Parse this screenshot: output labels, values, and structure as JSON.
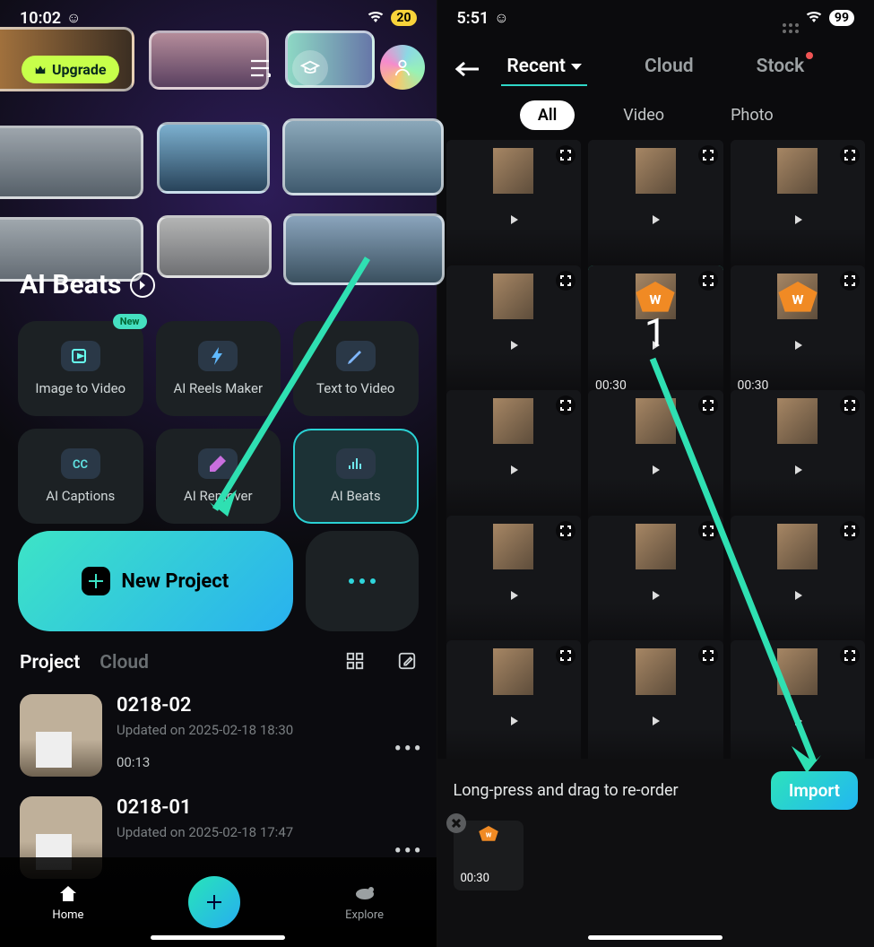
{
  "left": {
    "status_time": "10:02",
    "status_emoji": "☺",
    "battery": "20",
    "upgrade_label": "Upgrade",
    "section_title": "AI Beats",
    "tools": [
      {
        "label": "Image to Video",
        "badge": "New"
      },
      {
        "label": "AI Reels Maker"
      },
      {
        "label": "Text  to Video"
      },
      {
        "label": "AI Captions"
      },
      {
        "label": "AI Remover"
      },
      {
        "label": "AI Beats"
      }
    ],
    "new_project_label": "New Project",
    "project_tab": "Project",
    "cloud_tab": "Cloud",
    "projects": [
      {
        "title": "0218-02",
        "updated": "Updated on 2025-02-18 18:30",
        "duration": "00:13"
      },
      {
        "title": "0218-01",
        "updated": "Updated on 2025-02-18 17:47",
        "duration": ""
      }
    ],
    "bottom": {
      "home": "Home",
      "explore": "Explore"
    }
  },
  "right": {
    "status_time": "5:51",
    "status_emoji": "☺",
    "battery": "99",
    "tabs": {
      "recent": "Recent",
      "cloud": "Cloud",
      "stock": "Stock"
    },
    "filters": {
      "all": "All",
      "video": "Video",
      "photo": "Photo"
    },
    "media": [
      {
        "dur": ""
      },
      {
        "dur": ""
      },
      {
        "dur": ""
      },
      {
        "dur": ""
      },
      {
        "dur": "00:30",
        "selected": true,
        "sel_label": "1",
        "wbadge": true
      },
      {
        "dur": "00:30",
        "wbadge": true
      },
      {
        "dur": ""
      },
      {
        "dur": ""
      },
      {
        "dur": ""
      },
      {
        "dur": ""
      },
      {
        "dur": ""
      },
      {
        "dur": ""
      },
      {
        "dur": ""
      },
      {
        "dur": ""
      },
      {
        "dur": ""
      }
    ],
    "tray_text": "Long-press and drag to re-order",
    "import_label": "Import",
    "selection": [
      {
        "dur": "00:30"
      }
    ]
  }
}
